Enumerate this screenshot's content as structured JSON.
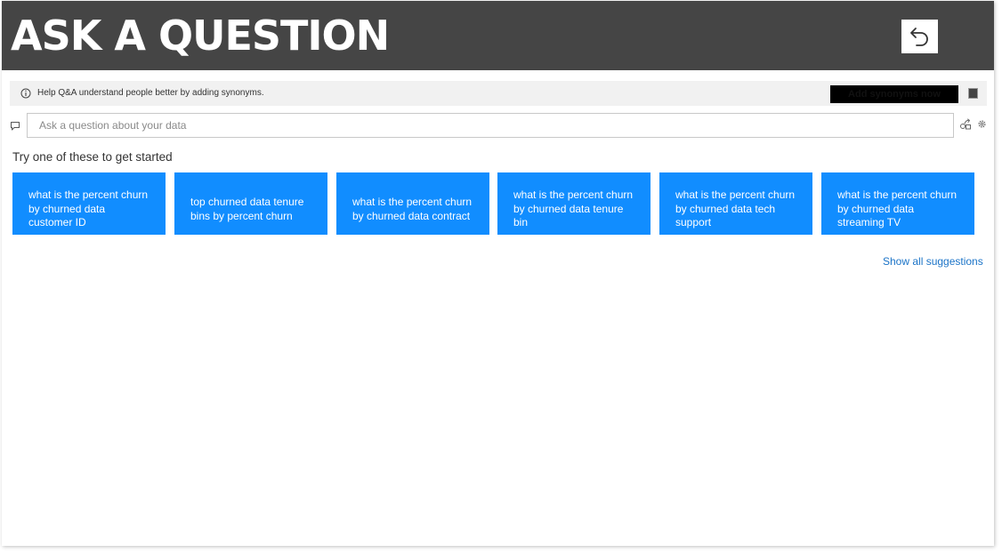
{
  "header": {
    "title": "ASK A QUESTION",
    "back_icon": "undo-arrow-icon"
  },
  "banner": {
    "info_icon": "info-icon",
    "text": "Help Q&A understand people better by adding synonyms.",
    "button_label": "Add synonyms now",
    "close_icon": "close-icon"
  },
  "search": {
    "placeholder": "Ask a question about your data",
    "value": "",
    "chat_icon": "chat-bubble-icon",
    "share_icon": "share-icon",
    "settings_icon": "gear-icon"
  },
  "suggestions": {
    "heading": "Try one of these to get started",
    "items": [
      "what is the percent churn by churned data customer ID",
      "top churned data tenure bins by percent churn",
      "what is the percent churn by churned data contract",
      "what is the percent churn by churned data tenure bin",
      "what is the percent churn by churned data tech support",
      "what is the percent churn by churned data streaming TV"
    ],
    "show_all": "Show all suggestions"
  },
  "colors": {
    "header_bg": "#454545",
    "suggestion_bg": "#118dff",
    "link": "#1a73c7",
    "banner_bg": "#f1f1f1"
  }
}
